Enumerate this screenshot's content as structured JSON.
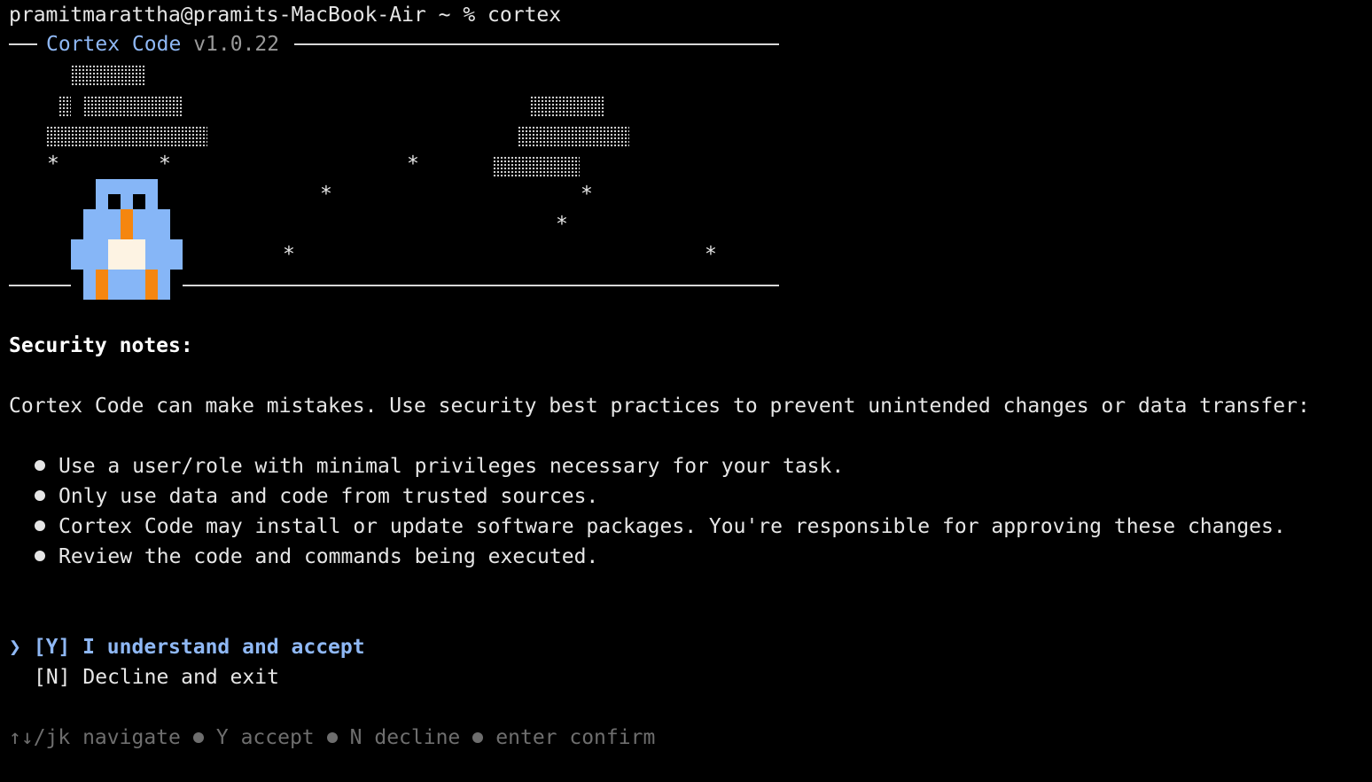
{
  "prompt": "pramitmarattha@pramits-MacBook-Air ~ % cortex",
  "header": {
    "name": "Cortex Code",
    "version": "v1.0.22"
  },
  "security": {
    "title": "Security notes:",
    "intro": "Cortex Code can make mistakes. Use security best practices to prevent unintended changes or data transfer:",
    "bullets": [
      "Use a user/role with minimal privileges necessary for your task.",
      "Only use data and code from trusted sources.",
      "Cortex Code may install or update software packages. You're responsible for approving these changes.",
      "Review the code and commands being executed."
    ]
  },
  "options": {
    "cursor": "❯",
    "accept": "[Y] I understand and accept",
    "decline": "[N] Decline and exit"
  },
  "hints": [
    "↑↓/jk navigate",
    "Y accept",
    "N decline",
    "enter confirm"
  ],
  "colors": {
    "accent": "#8fb8f5",
    "mascot_body": "#86b6f7",
    "mascot_beak": "#f5860f",
    "mascot_belly": "#fdf3e3"
  },
  "icons": {
    "mascot": "penguin-mascot-icon",
    "cursor": "chevron-right-icon"
  }
}
